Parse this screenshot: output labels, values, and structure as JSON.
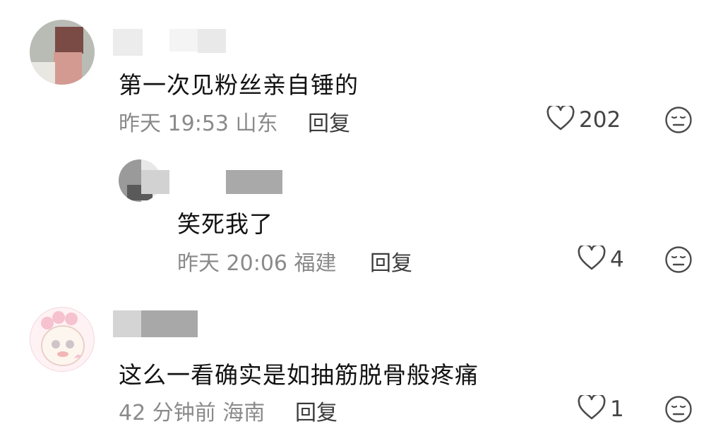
{
  "comments": [
    {
      "text": "第一次见粉丝亲自锤的",
      "time": "昨天 19:53",
      "location": "山东",
      "reply_label": "回复",
      "likes": "202"
    },
    {
      "text": "笑死我了",
      "time": "昨天 20:06",
      "location": "福建",
      "reply_label": "回复",
      "likes": "4"
    },
    {
      "text": "这么一看确实是如抽筋脱骨般疼痛",
      "time": "42 分钟前",
      "location": "海南",
      "reply_label": "回复",
      "likes": "1"
    }
  ],
  "icons": {
    "like": "heart-outline-icon",
    "reaction": "neutral-face-icon"
  },
  "colors": {
    "text": "#121212",
    "meta": "#8a8a8a",
    "icon": "#4a4a4a"
  }
}
